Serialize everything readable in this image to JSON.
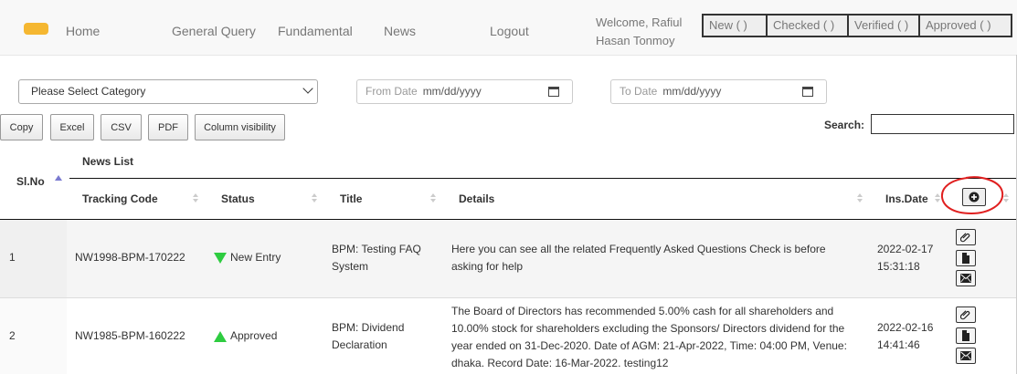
{
  "nav": {
    "links": [
      "Home",
      "General Query",
      "Fundamental",
      "News",
      "Logout"
    ],
    "welcome_line1": "Welcome, Rafiul",
    "welcome_line2": "Hasan Tonmoy",
    "workflow": [
      "New (    )",
      "Checked (  )",
      "Verified (  )",
      "Approved (    )"
    ],
    "brand_color": "#f5b731"
  },
  "filters": {
    "category_placeholder": "Please Select Category",
    "from_label": "From Date",
    "to_label": "To Date",
    "date_format": "mm/dd/yyyy"
  },
  "export_buttons": [
    "Copy",
    "Excel",
    "CSV",
    "PDF",
    "Column visibility"
  ],
  "search": {
    "label": "Search:",
    "value": ""
  },
  "table": {
    "group_header": "News List",
    "headers": {
      "slno": "Sl.No",
      "tracking": "Tracking Code",
      "status": "Status",
      "title": "Title",
      "details": "Details",
      "insdate": "Ins.Date"
    },
    "rows": [
      {
        "slno": "1",
        "tracking": "NW1998-BPM-170222",
        "status": "New Entry",
        "status_icon": "arrow-down-green",
        "title_line1": "BPM: Testing FAQ",
        "title_line2": "System",
        "details_lines": [
          "Here you can see all the related Frequently Asked Questions Check is before",
          "asking for help"
        ],
        "date": "2022-02-17",
        "time": "15:31:18"
      },
      {
        "slno": "2",
        "tracking": "NW1985-BPM-160222",
        "status": "Approved",
        "status_icon": "arrow-up-green",
        "title_line1": "BPM: Dividend",
        "title_line2": "Declaration",
        "details_lines": [
          "The Board of Directors has recommended 5.00% cash for all shareholders and",
          "10.00% stock for shareholders excluding the Sponsors/ Directors dividend for the",
          "year ended on 31-Dec-2020. Date of AGM: 21-Apr-2022, Time: 04:00 PM, Venue:",
          "dhaka. Record Date: 16-Mar-2022. testing12"
        ],
        "date": "2022-02-16",
        "time": "14:41:46"
      }
    ]
  },
  "colors": {
    "status_green": "#2ecc40",
    "annotation_red": "#e02020",
    "row_alt": "#f5f5f5"
  }
}
